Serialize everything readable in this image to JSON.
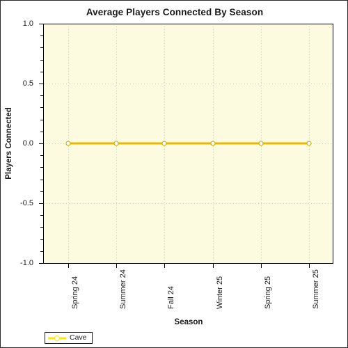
{
  "chart_data": {
    "type": "line",
    "title": "Average Players Connected By Season",
    "xlabel": "Season",
    "ylabel": "Players Connected",
    "categories": [
      "Spring 24",
      "Summer 24",
      "Fall 24",
      "Winter 25",
      "Spring 25",
      "Summer 25"
    ],
    "series": [
      {
        "name": "Cave",
        "values": [
          0.0,
          0.0,
          0.0,
          0.0,
          0.0,
          0.0
        ],
        "line_color": "#e8b800",
        "marker_fill": "#ffffff",
        "marker_outline": "#c9a400"
      }
    ],
    "ylim": [
      -1.0,
      1.0
    ],
    "y_ticks": [
      "1.0",
      "0.5",
      "0.0",
      "-0.5",
      "-1.0"
    ],
    "y_tick_values": [
      1.0,
      0.5,
      0.0,
      -0.5,
      -1.0
    ],
    "y_minor_tick_count": 4,
    "grid": true,
    "grid_color": "#cfcab0",
    "plot_background": "#fdfbdf",
    "chart_background": "#ffffff",
    "legend_position": "bottom-left",
    "x_tick_label_rotation": -90
  },
  "legend": {
    "entries": [
      {
        "label": "Cave"
      }
    ]
  }
}
